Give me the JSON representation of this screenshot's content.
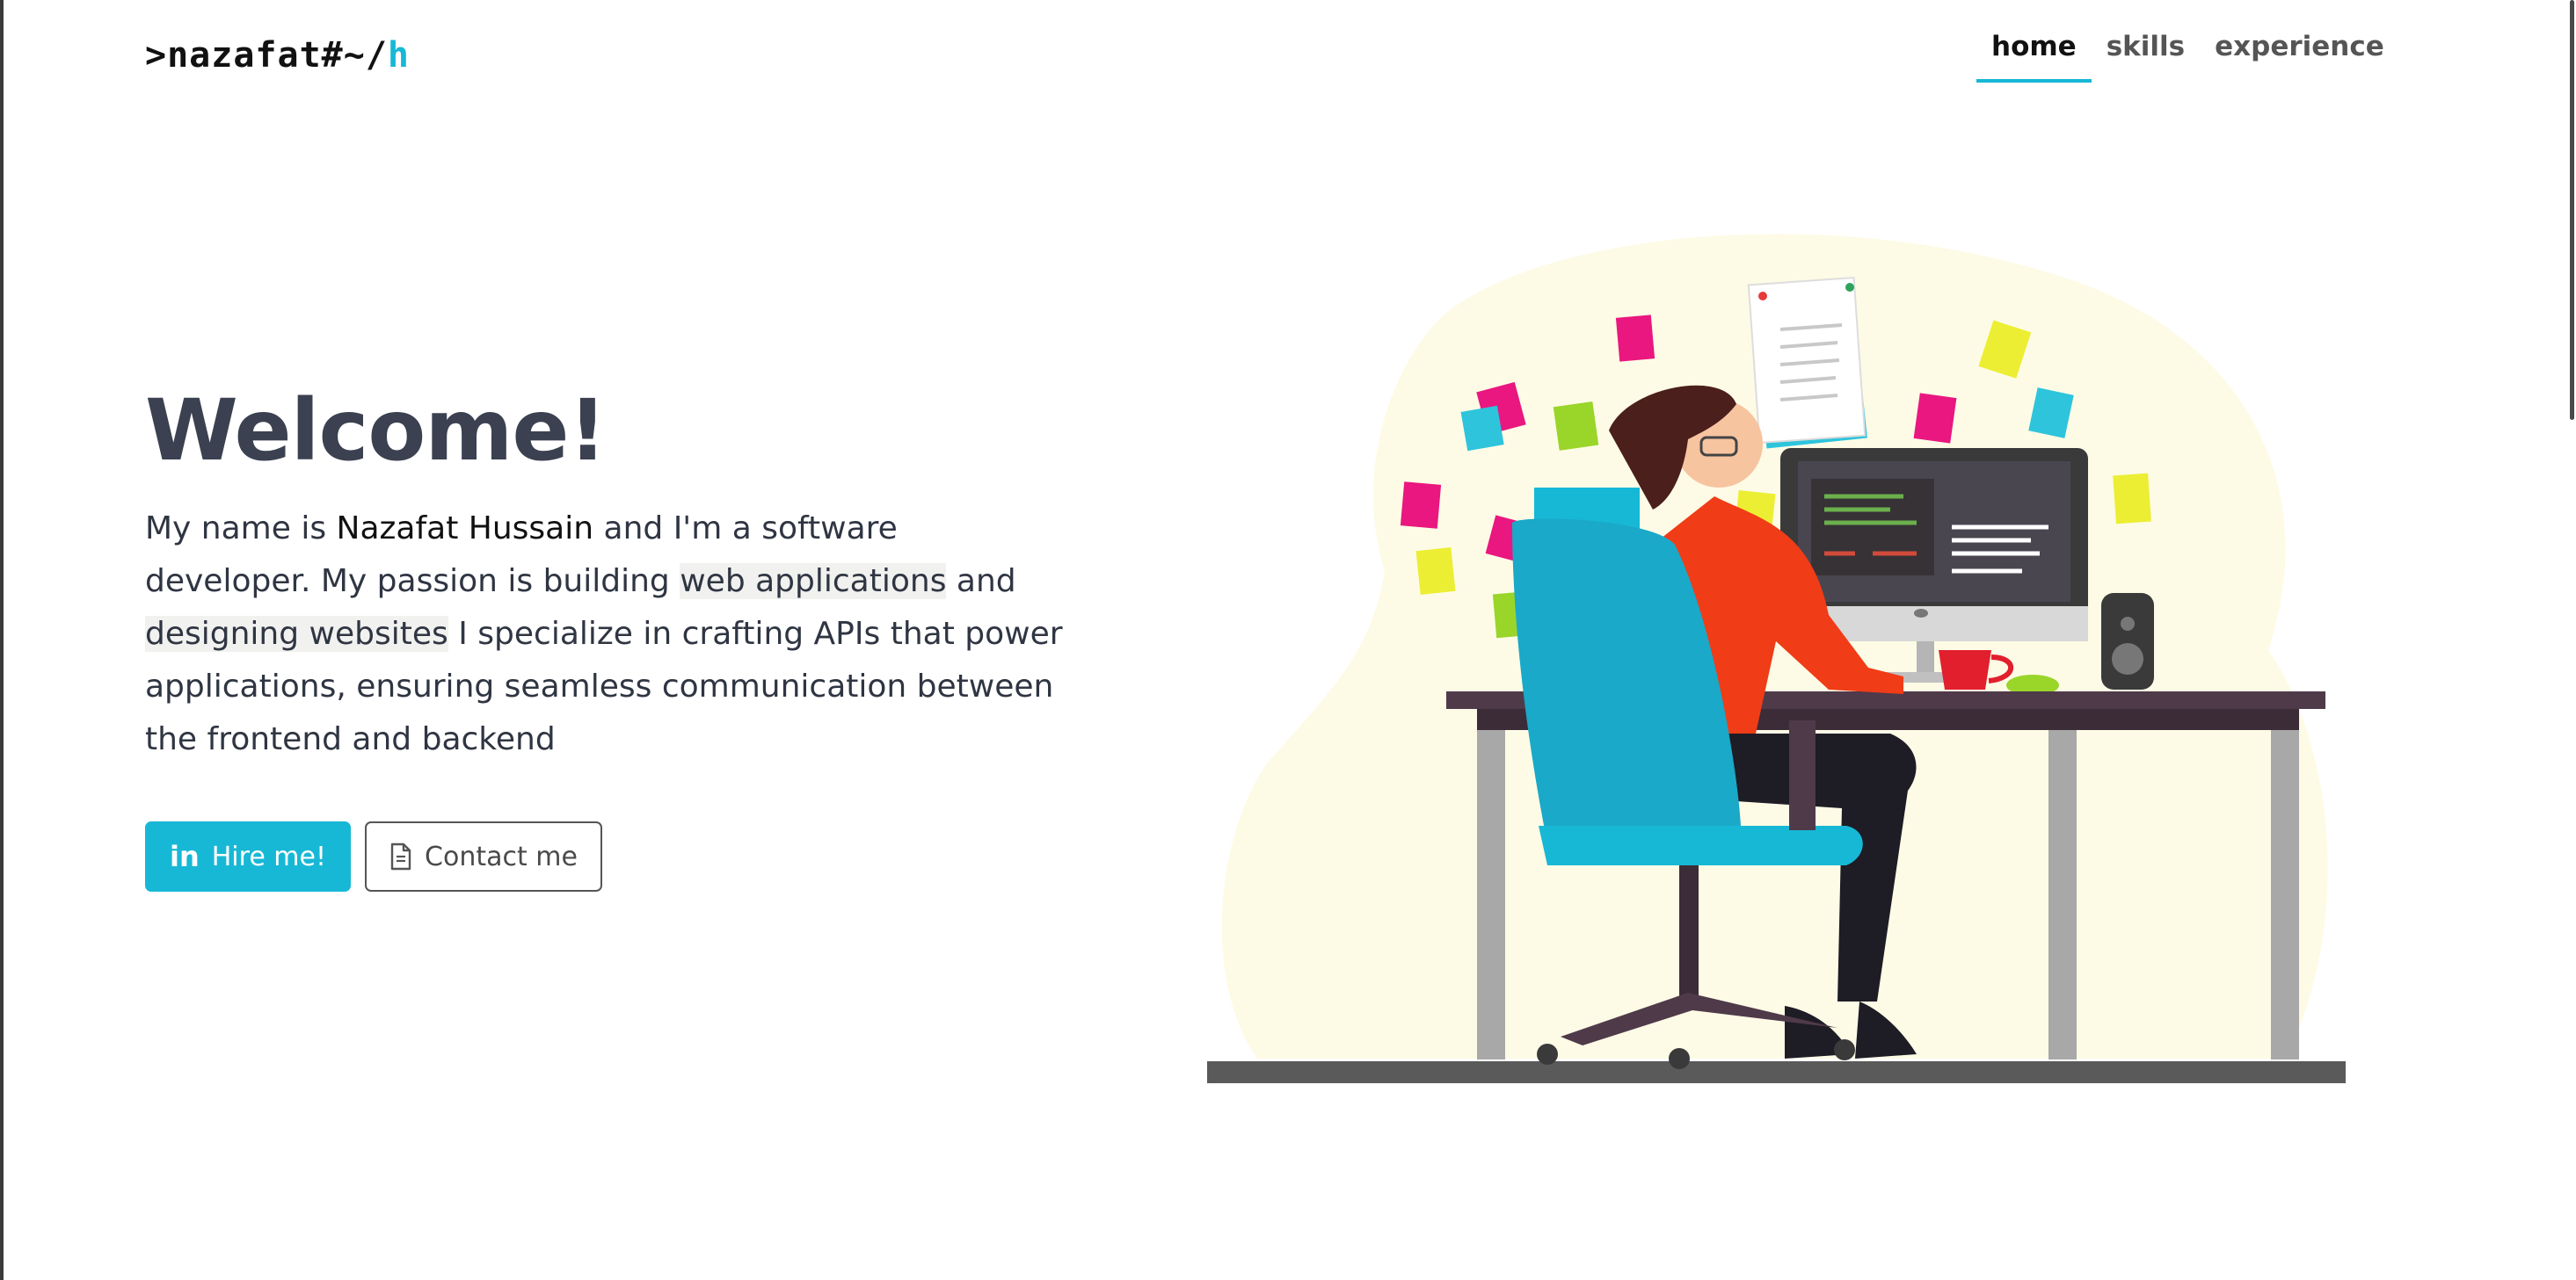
{
  "brand": {
    "prefix": ">nazafat#~/",
    "accent": "h",
    "accent_color": "#17b8d6"
  },
  "nav": {
    "items": [
      {
        "label": "home",
        "active": true
      },
      {
        "label": "skills",
        "active": false
      },
      {
        "label": "experience",
        "active": false
      }
    ]
  },
  "hero": {
    "title": "Welcome!",
    "intro": {
      "p1": "My name is ",
      "name": "Nazafat Hussain",
      "p2": " and I'm a software developer. My passion is building ",
      "hl1": "web applications",
      "p3": " and ",
      "hl2": "designing websites",
      "p4": " I specialize in crafting APIs that power applications, ensuring seamless communication between the frontend and backend"
    },
    "buttons": {
      "hire": {
        "label": "Hire me!",
        "icon": "linkedin-icon"
      },
      "contact": {
        "label": "Contact me",
        "icon": "document-icon"
      }
    }
  },
  "illustration": {
    "subject": "developer-at-desk-illustration"
  }
}
